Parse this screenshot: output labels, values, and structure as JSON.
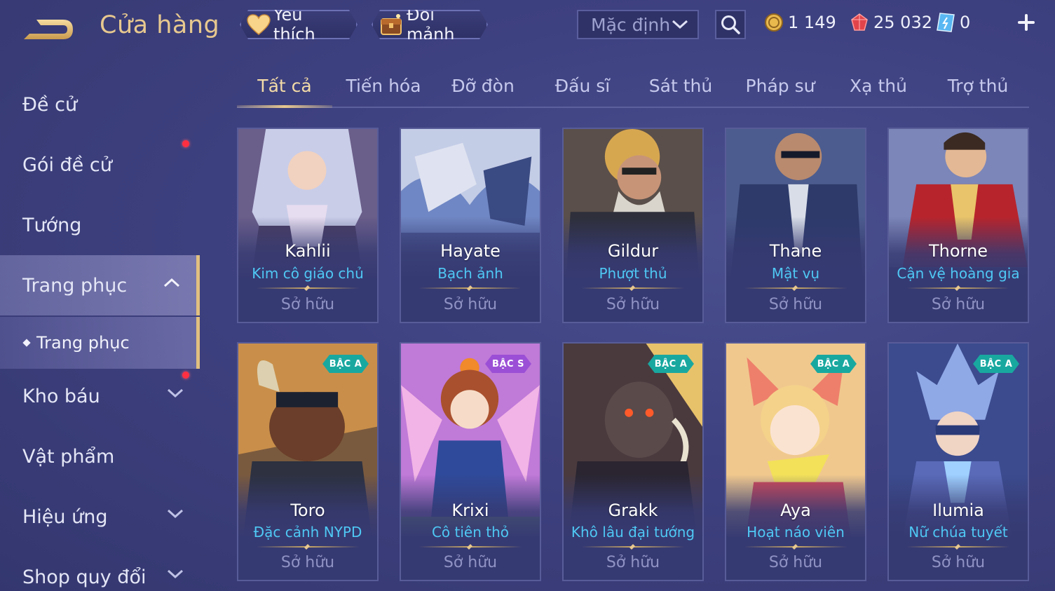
{
  "header": {
    "title": "Cửa hàng",
    "favorite_label": "Yêu thích",
    "exchange_label": "Đổi mảnh",
    "sort_value": "Mặc định",
    "gold": "1 149",
    "voucher": "25 032",
    "gem": "0"
  },
  "sidebar": {
    "items": [
      {
        "label": "Đề cử"
      },
      {
        "label": "Gói đề cử"
      },
      {
        "label": "Tướng"
      },
      {
        "label": "Trang phục"
      },
      {
        "label": "Trang phục"
      },
      {
        "label": "Kho báu"
      },
      {
        "label": "Vật phẩm"
      },
      {
        "label": "Hiệu ứng"
      },
      {
        "label": "Shop quy đổi"
      }
    ]
  },
  "tabs": [
    {
      "label": "Tất cả"
    },
    {
      "label": "Tiến hóa"
    },
    {
      "label": "Đỡ đòn"
    },
    {
      "label": "Đấu sĩ"
    },
    {
      "label": "Sát thủ"
    },
    {
      "label": "Pháp sư"
    },
    {
      "label": "Xạ thủ"
    },
    {
      "label": "Trợ thủ"
    }
  ],
  "cards": [
    {
      "hero": "Kahlii",
      "skin": "Kim cô giáo chủ",
      "status": "Sở hữu"
    },
    {
      "hero": "Hayate",
      "skin": "Bạch ảnh",
      "status": "Sở hữu"
    },
    {
      "hero": "Gildur",
      "skin": "Phượt thủ",
      "status": "Sở hữu"
    },
    {
      "hero": "Thane",
      "skin": "Mật vụ",
      "status": "Sở hữu"
    },
    {
      "hero": "Thorne",
      "skin": "Cận vệ hoàng gia",
      "status": "Sở hữu"
    },
    {
      "hero": "Toro",
      "skin": "Đặc cảnh NYPD",
      "status": "Sở hữu",
      "rank": "BẬC A"
    },
    {
      "hero": "Krixi",
      "skin": "Cô tiên thỏ",
      "status": "Sở hữu",
      "rank": "BẬC S"
    },
    {
      "hero": "Grakk",
      "skin": "Khô lâu đại tướng",
      "status": "Sở hữu",
      "rank": "BẬC A"
    },
    {
      "hero": "Aya",
      "skin": "Hoạt náo viên",
      "status": "Sở hữu",
      "rank": "BẬC A"
    },
    {
      "hero": "Ilumia",
      "skin": "Nữ chúa tuyết",
      "status": "Sở hữu",
      "rank": "BẬC A"
    }
  ],
  "colors": {
    "accent_gold": "#e7c88f",
    "skin_name": "#4fc8f4",
    "rank_a": "#19a8a0",
    "rank_s": "#9b4fd6",
    "notification": "#ff2f42"
  }
}
